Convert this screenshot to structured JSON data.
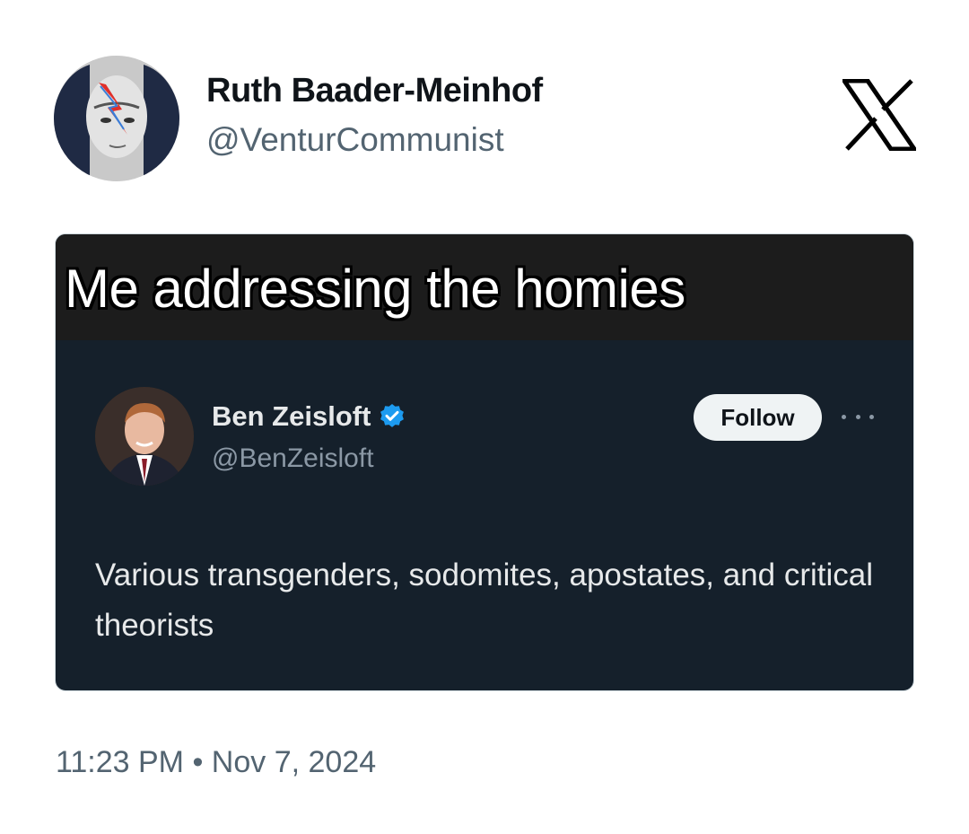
{
  "author": {
    "name": "Ruth Baader-Meinhof",
    "handle": "@VenturCommunist",
    "avatar_icon": "avatar-lightning-face"
  },
  "platform_icon": "x-logo-icon",
  "media": {
    "caption": "Me addressing the homies",
    "embedded_post": {
      "name": "Ben Zeisloft",
      "verified_icon": "verified-badge-icon",
      "handle": "@BenZeisloft",
      "follow_label": "Follow",
      "more_icon": "more-options-icon",
      "text": "Various transgenders, sodomites, apostates, and critical theorists",
      "colors": {
        "background": "#15202b",
        "verified": "#1d9bf0"
      }
    }
  },
  "timestamp": "11:23 PM • Nov 7, 2024"
}
